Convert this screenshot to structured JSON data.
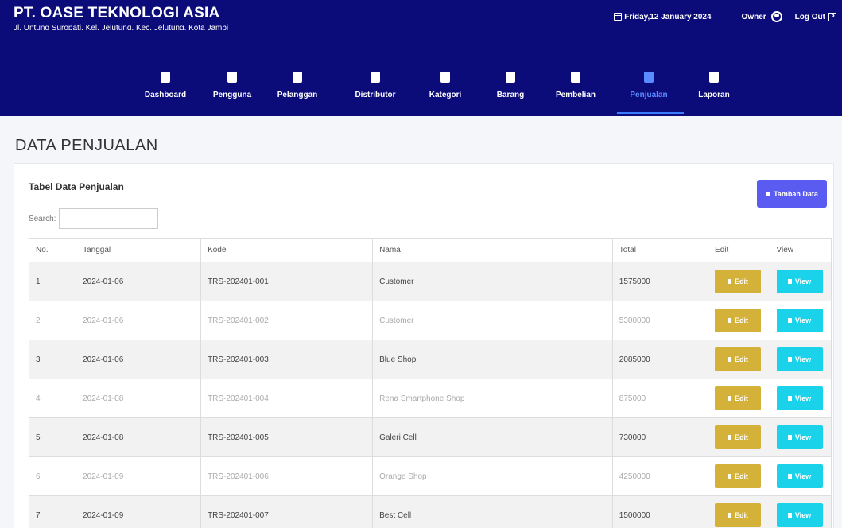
{
  "header": {
    "brand": "PT. OASE TEKNOLOGI ASIA",
    "address": "Jl. Untung Suropati, Kel. Jelutung, Kec. Jelutung, Kota Jambi",
    "date": "Friday,12 January 2024",
    "user_label": "Owner",
    "logout_label": "Log Out"
  },
  "nav": {
    "items": [
      {
        "label": "Dashboard",
        "icon": "dashboard-icon"
      },
      {
        "label": "Pengguna",
        "icon": "users-icon"
      },
      {
        "label": "Pelanggan",
        "icon": "id-card-icon"
      },
      {
        "label": "Distributor",
        "icon": "truck-icon"
      },
      {
        "label": "Kategori",
        "icon": "bookmark-icon"
      },
      {
        "label": "Barang",
        "icon": "box-icon"
      },
      {
        "label": "Pembelian",
        "icon": "money-icon"
      },
      {
        "label": "Penjualan",
        "icon": "cart-icon"
      },
      {
        "label": "Laporan",
        "icon": "file-icon"
      }
    ],
    "active": "Penjualan"
  },
  "page": {
    "title": "DATA PENJUALAN",
    "card_title": "Tabel Data Penjualan",
    "add_button": "Tambah Data",
    "search_label": "Search:",
    "search_value": ""
  },
  "table": {
    "headers": [
      "No.",
      "Tanggal",
      "Kode",
      "Nama",
      "Total",
      "Edit",
      "View"
    ],
    "edit_label": "Edit",
    "view_label": "View",
    "rows": [
      {
        "no": "1",
        "tanggal": "2024-01-06",
        "kode": "TRS-202401-001",
        "nama": "Customer",
        "total": "1575000"
      },
      {
        "no": "2",
        "tanggal": "2024-01-06",
        "kode": "TRS-202401-002",
        "nama": "Customer",
        "total": "5300000"
      },
      {
        "no": "3",
        "tanggal": "2024-01-06",
        "kode": "TRS-202401-003",
        "nama": "Blue Shop",
        "total": "2085000"
      },
      {
        "no": "4",
        "tanggal": "2024-01-08",
        "kode": "TRS-202401-004",
        "nama": "Rena Smartphone Shop",
        "total": "875000"
      },
      {
        "no": "5",
        "tanggal": "2024-01-08",
        "kode": "TRS-202401-005",
        "nama": "Galeri Cell",
        "total": "730000"
      },
      {
        "no": "6",
        "tanggal": "2024-01-09",
        "kode": "TRS-202401-006",
        "nama": "Orange Shop",
        "total": "4250000"
      },
      {
        "no": "7",
        "tanggal": "2024-01-09",
        "kode": "TRS-202401-007",
        "nama": "Best Cell",
        "total": "1500000"
      }
    ]
  },
  "colors": {
    "navbar": "#0b0b7a",
    "active_nav": "#5b8cff",
    "add_button": "#5a5bf0",
    "edit_button": "#d4b23a",
    "view_button": "#1ad3ea"
  }
}
